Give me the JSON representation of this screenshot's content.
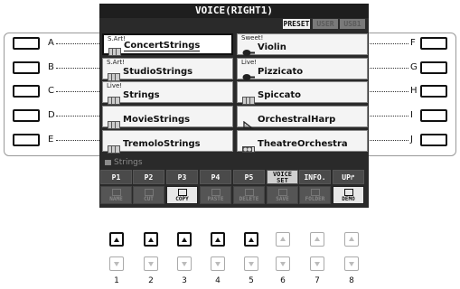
{
  "screen": {
    "title": "VOICE(RIGHT1)",
    "tabs": [
      {
        "label": "PRESET",
        "active": true
      },
      {
        "label": "USER",
        "active": false
      },
      {
        "label": "USB1",
        "active": false
      }
    ]
  },
  "side_buttons": {
    "left": [
      "A",
      "B",
      "C",
      "D",
      "E"
    ],
    "right": [
      "F",
      "G",
      "H",
      "I",
      "J"
    ]
  },
  "voices": {
    "left": [
      {
        "category": "S.Art!",
        "name": "ConcertStrings",
        "icon": "strings-icon",
        "selected": true
      },
      {
        "category": "S.Art!",
        "name": "StudioStrings",
        "icon": "strings-icon",
        "selected": false
      },
      {
        "category": "Live!",
        "name": "Strings",
        "icon": "strings-icon",
        "selected": false
      },
      {
        "category": "",
        "name": "MovieStrings",
        "icon": "strings-icon",
        "selected": false
      },
      {
        "category": "",
        "name": "TremoloStrings",
        "icon": "strings-icon",
        "selected": false
      }
    ],
    "right": [
      {
        "category": "Sweet!",
        "name": "Violin",
        "icon": "violin-icon",
        "selected": false
      },
      {
        "category": "Live!",
        "name": "Pizzicato",
        "icon": "violin-icon",
        "selected": false
      },
      {
        "category": "",
        "name": "Spiccato",
        "icon": "strings-icon",
        "selected": false
      },
      {
        "category": "",
        "name": "OrchestralHarp",
        "icon": "harp-icon",
        "selected": false
      },
      {
        "category": "",
        "name": "TheatreOrchestra",
        "icon": "orchestra-icon",
        "selected": false
      }
    ]
  },
  "status": {
    "category_path": "Strings"
  },
  "function_row": [
    {
      "label": "P1"
    },
    {
      "label": "P2"
    },
    {
      "label": "P3"
    },
    {
      "label": "P4"
    },
    {
      "label": "P5"
    },
    {
      "label": "VOICE SET"
    },
    {
      "label": "INFO."
    },
    {
      "label": "UP"
    }
  ],
  "sub_row": [
    {
      "label": "NAME",
      "enabled": false
    },
    {
      "label": "CUT",
      "enabled": false
    },
    {
      "label": "COPY",
      "enabled": true
    },
    {
      "label": "PASTE",
      "enabled": false
    },
    {
      "label": "DELETE",
      "enabled": false
    },
    {
      "label": "SAVE",
      "enabled": false
    },
    {
      "label": "FOLDER",
      "enabled": false
    },
    {
      "label": "DEMO",
      "enabled": true
    }
  ],
  "hardware_buttons": {
    "numbers": [
      "1",
      "2",
      "3",
      "4",
      "5",
      "6",
      "7",
      "8"
    ],
    "up_active": [
      true,
      true,
      true,
      true,
      true,
      false,
      false,
      false
    ]
  },
  "colors": {
    "lcd_bg": "#2a2a2a",
    "cell_bg": "#f4f4f4",
    "accent": "#111111"
  }
}
